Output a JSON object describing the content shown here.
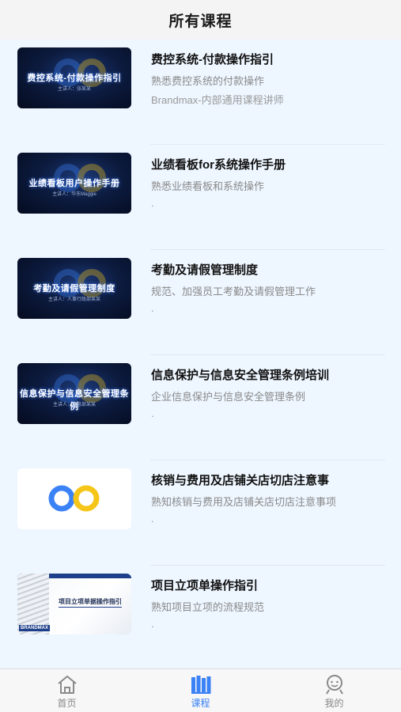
{
  "header": {
    "title": "所有课程"
  },
  "courses": [
    {
      "title": "费控系统-付款操作指引",
      "desc": "熟悉费控系统的付款操作",
      "meta": "Brandmax-内部通用课程讲师",
      "thumb_style": "dark",
      "thumb_text": "费控系统-付款操作指引",
      "thumb_sub": "主讲人：张某某"
    },
    {
      "title": "业绩看板for系统操作手册",
      "desc": "熟悉业绩看板和系统操作",
      "meta": ".",
      "thumb_style": "dark",
      "thumb_text": "业绩看板用户操作手册",
      "thumb_sub": "主讲人：华东Maggie"
    },
    {
      "title": "考勤及请假管理制度",
      "desc": "规范、加强员工考勤及请假管理工作",
      "meta": ".",
      "thumb_style": "dark",
      "thumb_text": "考勤及请假管理制度",
      "thumb_sub": "主讲人：人事行政部某某"
    },
    {
      "title": "信息保护与信息安全管理条例培训",
      "desc": "企业信息保护与信息安全管理条例",
      "meta": ".",
      "thumb_style": "dark",
      "thumb_text": "信息保护与信息安全管理条例",
      "thumb_sub": "主讲人：信息部某某"
    },
    {
      "title": "核销与费用及店铺关店切店注意事",
      "desc": "熟知核销与费用及店铺关店切店注意事项",
      "meta": ".",
      "thumb_style": "light",
      "thumb_text": "",
      "thumb_sub": ""
    },
    {
      "title": "项目立项单操作指引",
      "desc": "熟知项目立项的流程规范",
      "meta": ".",
      "thumb_style": "doc",
      "thumb_text": "项目立项单据操作指引",
      "thumb_sub": "BRANDMAX"
    }
  ],
  "tabbar": {
    "items": [
      {
        "label": "首页",
        "icon": "home-icon",
        "active": false
      },
      {
        "label": "课程",
        "icon": "books-icon",
        "active": true
      },
      {
        "label": "我的",
        "icon": "profile-icon",
        "active": false
      }
    ]
  },
  "colors": {
    "accent": "#3b82f6",
    "logo_blue": "#3b82f6",
    "logo_yellow": "#f5c518",
    "background": "#eef6ff"
  }
}
